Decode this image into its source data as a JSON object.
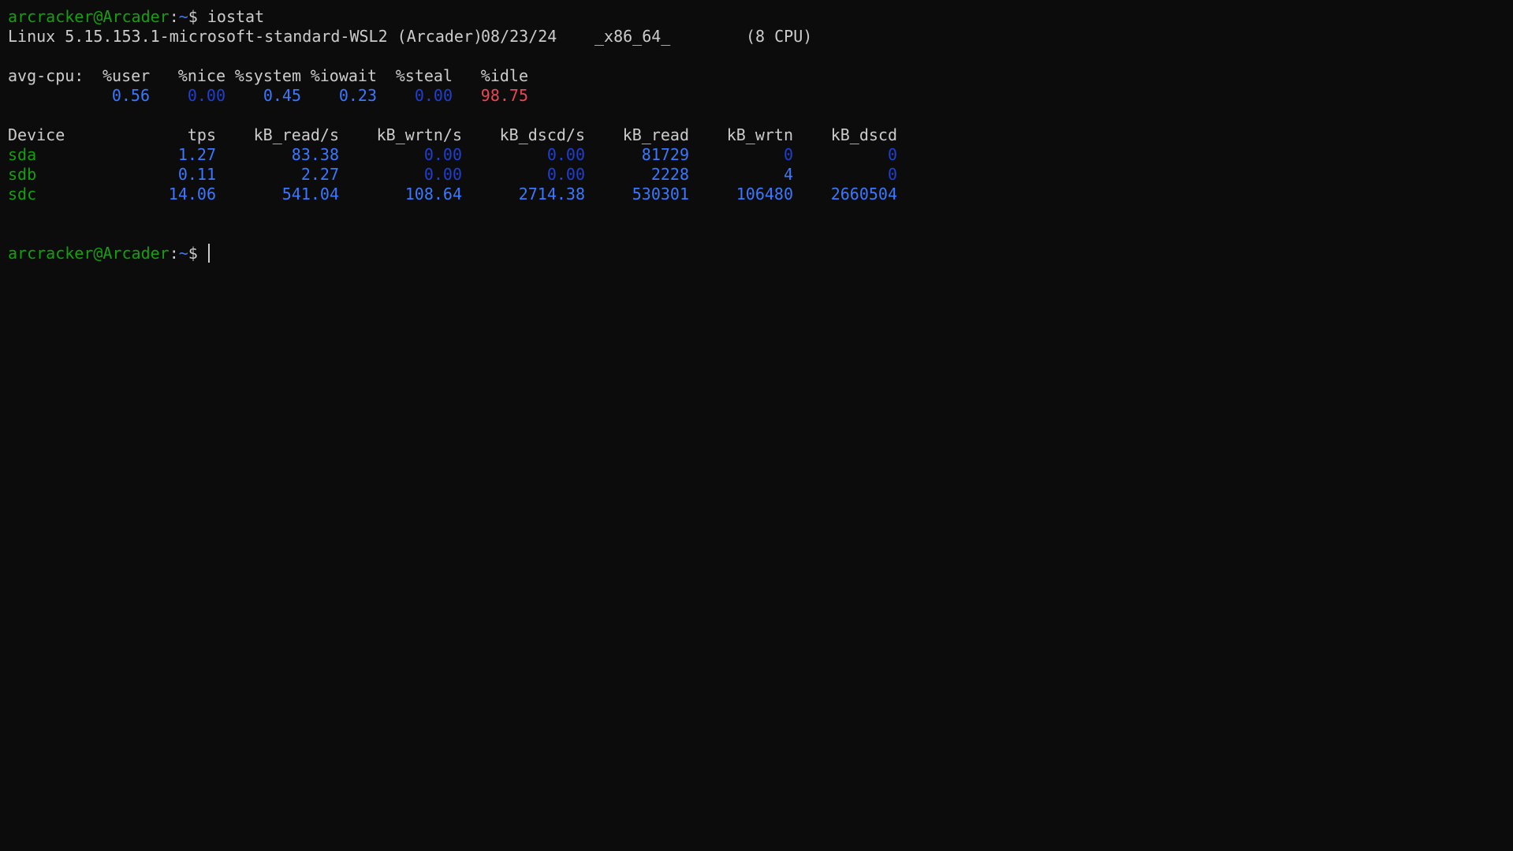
{
  "prompt": {
    "user_host": "arcracker@Arcader",
    "separator": ":",
    "path": "~",
    "symbol": "$ "
  },
  "command": "iostat",
  "header": {
    "kernel": "Linux 5.15.153.1-microsoft-standard-WSL2 (Arcader)",
    "date": "08/23/24",
    "arch": "_x86_64_",
    "cpus": "(8 CPU)"
  },
  "cpu": {
    "label": "avg-cpu:",
    "headers": [
      "%user",
      "%nice",
      "%system",
      "%iowait",
      "%steal",
      "%idle"
    ],
    "values": [
      "0.56",
      "0.00",
      "0.45",
      "0.23",
      "0.00",
      "98.75"
    ]
  },
  "devices": {
    "headers": [
      "Device",
      "tps",
      "kB_read/s",
      "kB_wrtn/s",
      "kB_dscd/s",
      "kB_read",
      "kB_wrtn",
      "kB_dscd"
    ],
    "rows": [
      [
        "sda",
        "1.27",
        "83.38",
        "0.00",
        "0.00",
        "81729",
        "0",
        "0"
      ],
      [
        "sdb",
        "0.11",
        "2.27",
        "0.00",
        "0.00",
        "2228",
        "4",
        "0"
      ],
      [
        "sdc",
        "14.06",
        "541.04",
        "108.64",
        "2714.38",
        "530301",
        "106480",
        "2660504"
      ]
    ]
  },
  "colors": {
    "background": "#0c0c0c",
    "foreground": "#cccccc",
    "prompt_green": "#13a10e",
    "value_blue": "#3b78ff",
    "zero_blue": "#1f3fd0",
    "idle_red": "#e74856"
  }
}
